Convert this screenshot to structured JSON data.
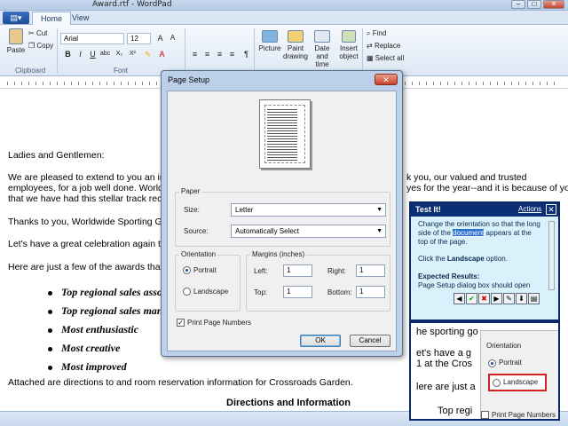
{
  "window": {
    "title": "Award.rtf - WordPad"
  },
  "ribbon": {
    "tabs": [
      "Home",
      "View"
    ],
    "clipboard": {
      "paste": "Paste",
      "cut": "Cut",
      "copy": "Copy",
      "label": "Clipboard"
    },
    "font": {
      "name": "Arial",
      "size": "12",
      "label": "Font"
    },
    "insert": {
      "picture": "Picture",
      "paint": "Paint",
      "paint2": "drawing",
      "datetime": "Date and",
      "datetime2": "time",
      "object": "Insert",
      "object2": "object"
    },
    "editing": {
      "find": "Find",
      "replace": "Replace",
      "select_all": "Select all"
    }
  },
  "document": {
    "greeting": "Ladies and Gentlemen:",
    "p1a": "We are pleased to extend to you an invita",
    "p1a_r": "k you, our valued and trusted",
    "p1b": "employees, for a job well done.  Worldwid",
    "p1b_r": "yes for the year--and it is because of you",
    "p1c": "that we have had this stellar track record.",
    "p2": "Thanks to you, Worldwide Sporting Gooc",
    "p3": "Let's have a great celebration again this y",
    "p4": "Here are just a few of the awards that will",
    "awards": [
      "Top regional sales asso",
      "Top regional sales man",
      "Most enthusiastic",
      "Most creative",
      "Most improved"
    ],
    "p5": "Attached are directions to and room reservation information for Crossroads Garden.",
    "heading": "Directions and Information"
  },
  "dialog": {
    "title": "Page Setup",
    "paper_label": "Paper",
    "size_label": "Size:",
    "size_value": "Letter",
    "source_label": "Source:",
    "source_value": "Automatically Select",
    "orientation_label": "Orientation",
    "portrait": "Portrait",
    "landscape": "Landscape",
    "margins_label": "Margins (inches)",
    "left_label": "Left:",
    "left": "1",
    "right_label": "Right:",
    "right": "1",
    "top_label": "Top:",
    "top": "1",
    "bottom_label": "Bottom:",
    "bottom": "1",
    "print_numbers": "Print Page Numbers",
    "ok": "OK",
    "cancel": "Cancel"
  },
  "testit": {
    "title": "Test It!",
    "actions": "Actions",
    "line1": "Change the orientation so that the long",
    "line2a": "side of the ",
    "line2b": "document",
    "line2c": " appears at the",
    "line3": "top of the page.",
    "line4a": "Click the ",
    "line4b": "Landscape",
    "line4c": " option.",
    "expected": "Expected Results:",
    "expected2": "Page Setup dialog box should open"
  },
  "zoom": {
    "t1": "he sporting go",
    "t2": "et's have a g",
    "t3": "1 at the Cros",
    "t4": "lere are just a",
    "t5": "Top regi",
    "orientation": "Orientation",
    "portrait": "Portrait",
    "landscape": "Landscape",
    "print_numbers": "Print Page Numbers"
  }
}
